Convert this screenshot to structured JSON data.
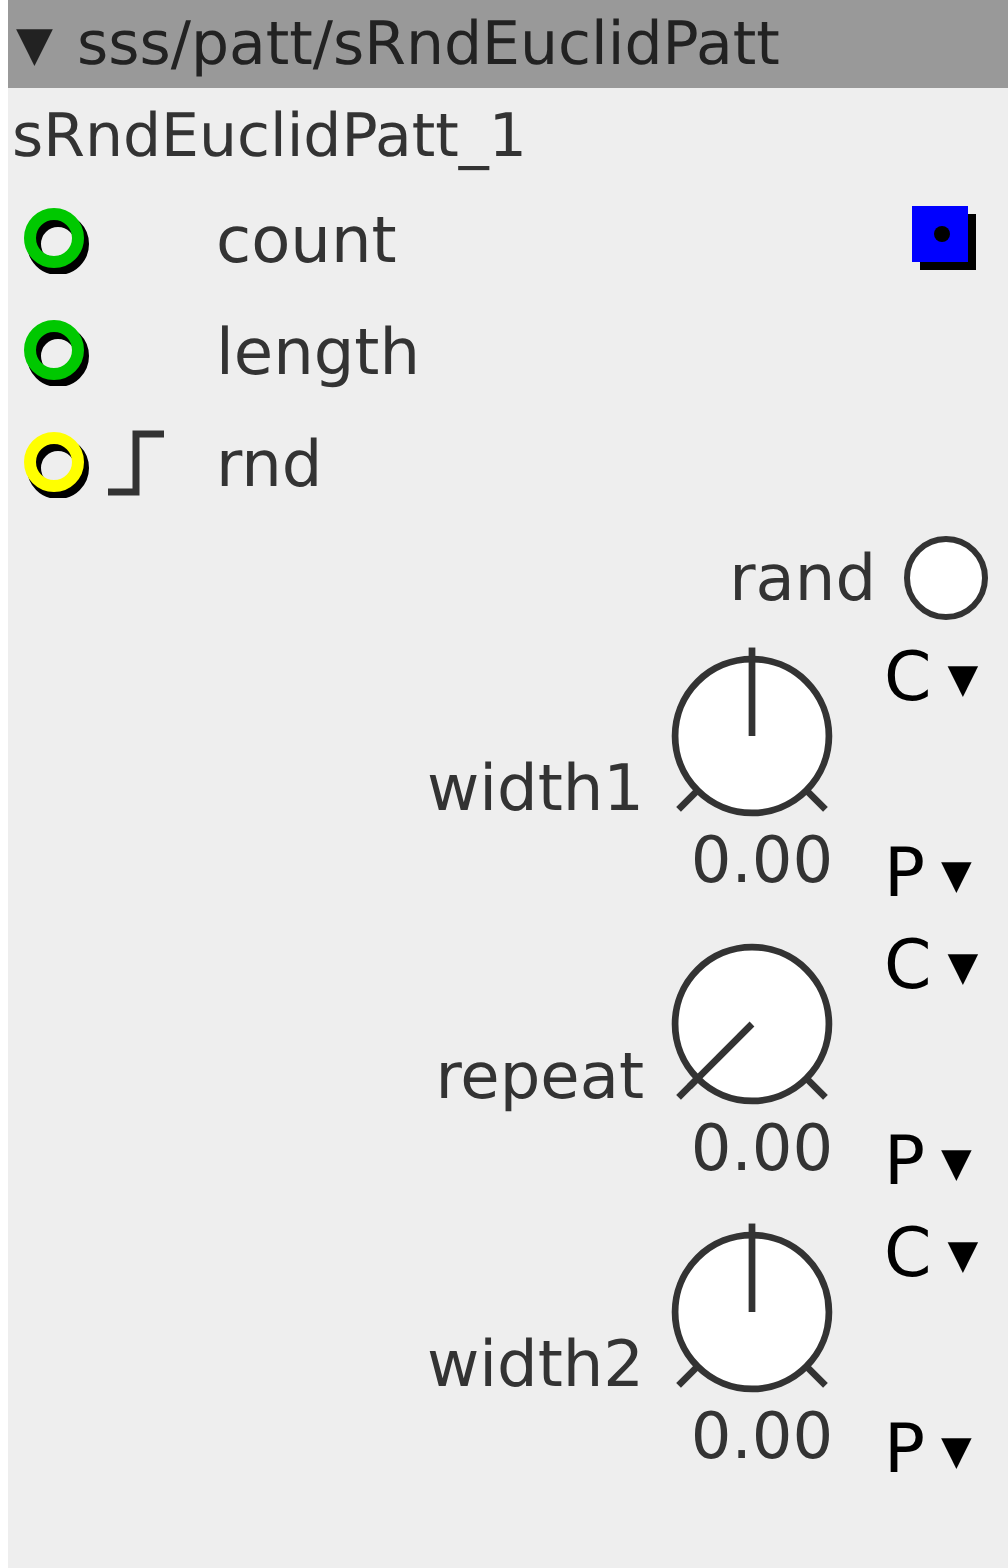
{
  "header": {
    "toggle": "▼",
    "title": "sss/patt/sRndEuclidPatt"
  },
  "instance_name": "sRndEuclidPatt_1",
  "ports": [
    {
      "label": "count",
      "kind": "frac",
      "trigger": false,
      "outlet": true
    },
    {
      "label": "length",
      "kind": "frac",
      "trigger": false,
      "outlet": false
    },
    {
      "label": "rnd",
      "kind": "bool",
      "trigger": true,
      "outlet": false
    }
  ],
  "toggle": {
    "label": "rand",
    "on": false
  },
  "knobs": [
    {
      "label": "width1",
      "value": "0.00",
      "top": {
        "label": "C",
        "arrow": "▼"
      },
      "bottom": {
        "label": "P",
        "arrow": "▼"
      }
    },
    {
      "label": "repeat",
      "value": "0.00",
      "top": {
        "label": "C",
        "arrow": "▼"
      },
      "bottom": {
        "label": "P",
        "arrow": "▼"
      }
    },
    {
      "label": "width2",
      "value": "0.00",
      "top": {
        "label": "C",
        "arrow": "▼"
      },
      "bottom": {
        "label": "P",
        "arrow": "▼"
      }
    }
  ]
}
